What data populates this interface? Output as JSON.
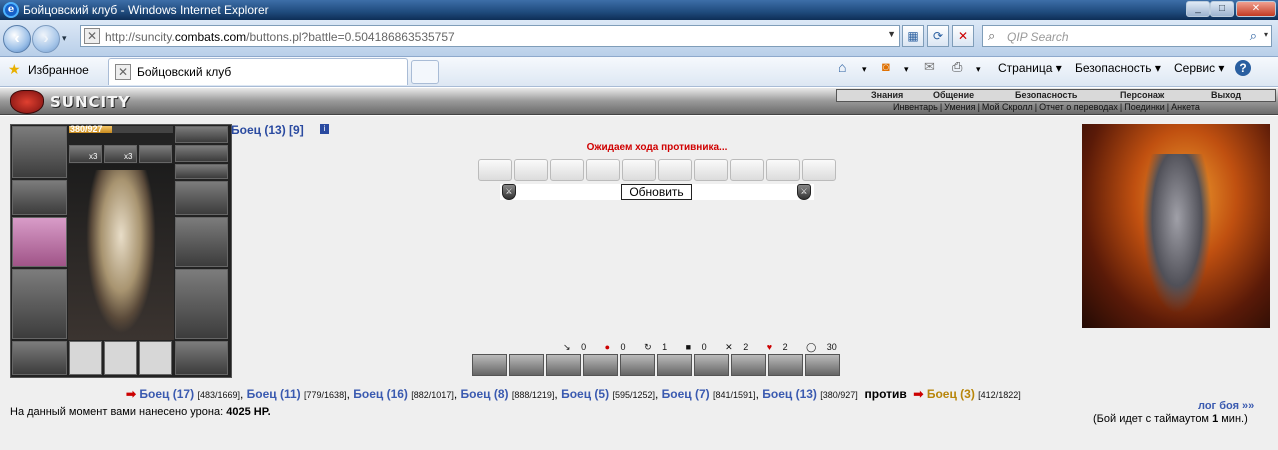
{
  "window": {
    "title": "Бойцовский клуб - Windows Internet Explorer",
    "controls": [
      "_",
      "□",
      "✕"
    ]
  },
  "browser": {
    "url_prefix": "http://suncity.",
    "url_domain": "combats.com",
    "url_path": "/buttons.pl?battle=0.504186863535757",
    "search_placeholder": "QIP Search",
    "favorites_label": "Избранное",
    "tab_title": "Бойцовский клуб",
    "commands": [
      "Страница ▾",
      "Безопасность ▾",
      "Сервис ▾"
    ]
  },
  "game": {
    "logo": "SUNCITY",
    "top_menu": [
      "Знания",
      "Общение",
      "Безопасность",
      "Персонаж",
      "Выход"
    ],
    "sub_menu": [
      "Инвентарь",
      "Умения",
      "Мой Скролл",
      "Отчет о переводах",
      "Поединки",
      "Анкета"
    ],
    "player": {
      "hp": "380/927",
      "hp_fraction": 0.41,
      "badges": [
        "x3",
        "x3"
      ]
    },
    "enemy": {
      "name": "Боец",
      "level": "(13)",
      "index": "[9]",
      "info": "i"
    },
    "status": "Ожидаем хода противника...",
    "refresh_label": "Обновить",
    "stats": [
      "0",
      "0",
      "1",
      "0",
      "2",
      "2",
      "30"
    ],
    "team_a": [
      {
        "name": "Боец (17)",
        "hp": "[483/1669]"
      },
      {
        "name": "Боец (11)",
        "hp": "[779/1638]"
      },
      {
        "name": "Боец (16)",
        "hp": "[882/1017]"
      },
      {
        "name": "Боец (8)",
        "hp": "[888/1219]"
      },
      {
        "name": "Боец (5)",
        "hp": "[595/1252]"
      },
      {
        "name": "Боец (7)",
        "hp": "[841/1591]"
      },
      {
        "name": "Боец (13)",
        "hp": "[380/927]"
      }
    ],
    "versus": "против",
    "team_b": [
      {
        "name": "Боец (3)",
        "hp": "[412/1822]"
      }
    ],
    "damage_prefix": "На данный момент вами нанесено урона: ",
    "damage_value": "4025 HP.",
    "log_link": "лог боя »»",
    "timeout_prefix": "(Бой идет с таймаутом ",
    "timeout_value": "1",
    "timeout_suffix": " мин.)"
  }
}
